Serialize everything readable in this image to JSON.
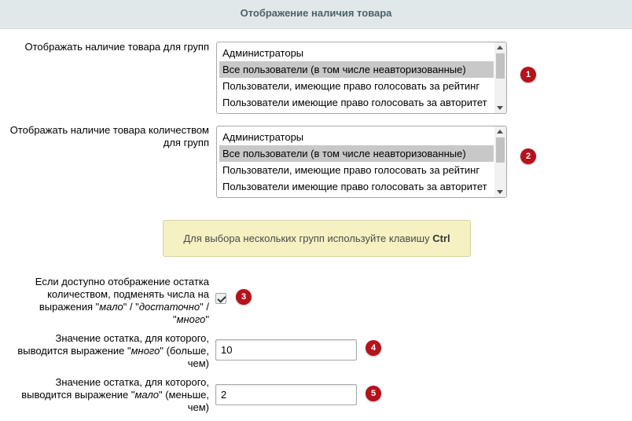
{
  "section": {
    "title": "Отображение наличия товара"
  },
  "fields": {
    "groups_availability": {
      "label": "Отображать наличие товара для групп",
      "options": [
        "Администраторы",
        "Все пользователи (в том числе неавторизованные)",
        "Пользователи, имеющие право голосовать за рейтинг",
        "Пользователи имеющие право голосовать за авторитет"
      ],
      "selected": "Все пользователи (в том числе неавторизованные)",
      "badge": "1"
    },
    "groups_quantity": {
      "label_line1": "Отображать наличие товара количеством",
      "label_line2": "для групп",
      "options": [
        "Администраторы",
        "Все пользователи (в том числе неавторизованные)",
        "Пользователи, имеющие право голосовать за рейтинг",
        "Пользователи имеющие право голосовать за авторитет"
      ],
      "selected": "Все пользователи (в том числе неавторизованные)",
      "badge": "2"
    },
    "notice": {
      "text": "Для выбора нескольких групп используйте клавишу ",
      "key": "Ctrl"
    },
    "replace_numbers": {
      "line1": "Если доступно отображение остатка",
      "line2": "количеством, подменять числа на",
      "line3_pre": "выражения \"",
      "word_few": "мало",
      "sep1": "\" / \"",
      "word_enough": "достаточно",
      "sep2": "\" /",
      "line4_pre": "\"",
      "word_many": "много",
      "line4_post": "\"",
      "checked": true,
      "badge": "3"
    },
    "many_threshold": {
      "line1": "Значение остатка, для которого,",
      "line2_pre": "выводится выражение \"",
      "word": "много",
      "line2_post": "\" (больше,",
      "line3": "чем)",
      "value": "10",
      "badge": "4"
    },
    "few_threshold": {
      "line1": "Значение остатка, для которого,",
      "line2_pre": "выводится выражение \"",
      "word": "мало",
      "line2_post": "\" (меньше,",
      "line3": "чем)",
      "value": "2",
      "badge": "5"
    }
  },
  "colors": {
    "badge": "#b5121b",
    "header_bg": "#e0e8ea",
    "notice_bg": "#f6f1c2",
    "selected_bg": "#c8c8c8"
  }
}
